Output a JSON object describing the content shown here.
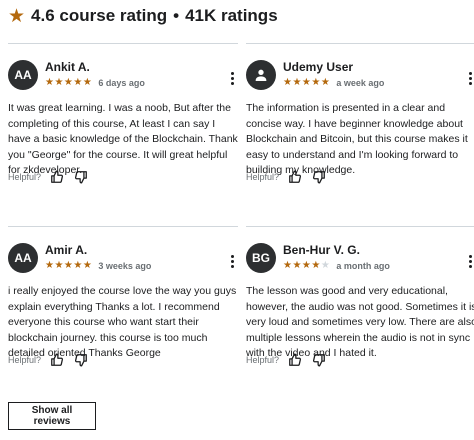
{
  "header": {
    "icon": "star-icon",
    "rating_text": "4.6 course rating",
    "separator": "•",
    "count_text": "41K ratings"
  },
  "reviews": [
    {
      "initials": "AA",
      "name": "Ankit A.",
      "stars": 5,
      "stars_text": "★★★★★",
      "date": "6 days ago",
      "text": "It was great learning. I was a noob, But after the completing of this course, At least I can say I have a basic knowledge of the Blockchain. Thank you \"George\" for the course. It will great helpful for zkdeveloper.",
      "helpful_label": "Helpful?"
    },
    {
      "initials": "",
      "avatar_icon": "user-icon",
      "name": "Udemy User",
      "stars": 5,
      "stars_text": "★★★★★",
      "date": "a week ago",
      "text": "The information is presented in a clear and concise way. I have beginner knowledge about Blockchain and Bitcoin, but this course makes it easy to understand and I'm looking forward to building my knowledge.",
      "helpful_label": "Helpful?"
    },
    {
      "initials": "AA",
      "name": "Amir A.",
      "stars": 5,
      "stars_text": "★★★★★",
      "date": "3 weeks ago",
      "text": "i really enjoyed the course love the way you guys explain everything Thanks a lot. I recommend everyone this course who want start their blockchain journey. this course is too much detailed oriented Thanks George",
      "helpful_label": "Helpful?"
    },
    {
      "initials": "BG",
      "name": "Ben-Hur V. G.",
      "stars": 4,
      "stars_text": "★★★★",
      "stars_empty_text": "★",
      "date": "a month ago",
      "text": "The lesson was good and very educational, however, the audio was not good. Sometimes it is very loud and sometimes very low. There are also multiple lessons wherein the audio is not in sync with the video and I hated it.",
      "helpful_label": "Helpful?"
    }
  ],
  "show_all_label": "Show all reviews",
  "colors": {
    "star": "#b4690e",
    "avatar_bg": "#2d2f31",
    "divider": "#d1d7dc",
    "muted": "#6a6f73"
  }
}
